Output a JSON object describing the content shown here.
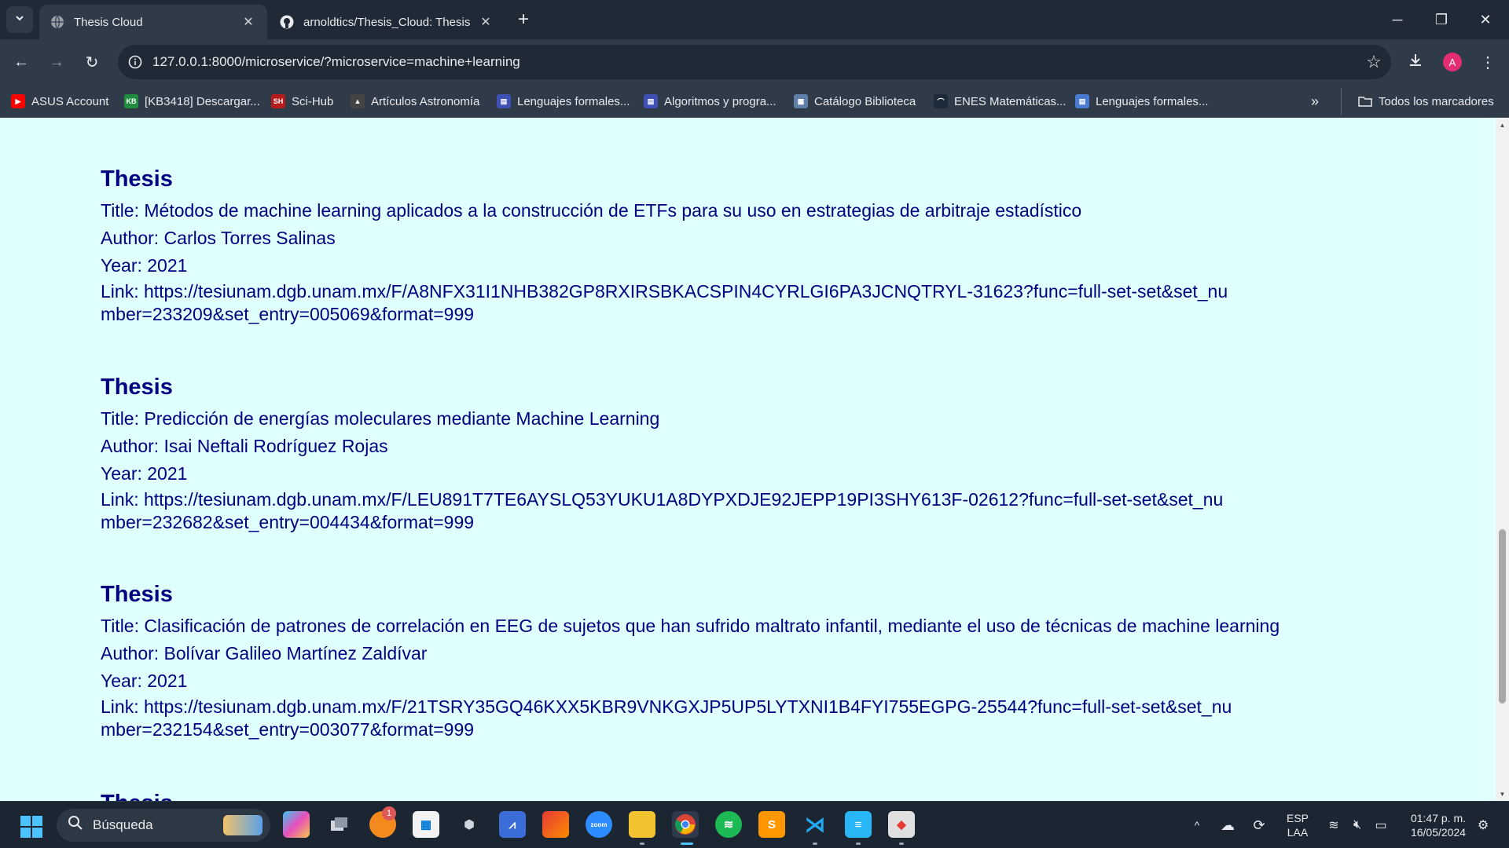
{
  "window": {
    "tabs": [
      {
        "title": "Thesis Cloud",
        "icon": "globe-icon",
        "active": true
      },
      {
        "title": "arnoldtics/Thesis_Cloud: Thesis",
        "icon": "github-icon",
        "active": false
      }
    ]
  },
  "toolbar": {
    "url": "127.0.0.1:8000/microservice/?microservice=machine+learning",
    "profile_initial": "A"
  },
  "bookmarks": {
    "items": [
      {
        "label": "ASUS Account",
        "icon": "youtube-icon",
        "color": "#ff0000"
      },
      {
        "label": "[KB3418] Descargar...",
        "icon": "kb-icon",
        "color": "#1e8e3e"
      },
      {
        "label": "Sci-Hub",
        "icon": "scihub-icon",
        "color": "#b71c1c"
      },
      {
        "label": "Artículos Astronomía",
        "icon": "astro-icon",
        "color": "#444444"
      },
      {
        "label": "Lenguajes formales...",
        "icon": "doc-icon",
        "color": "#3f51b5"
      },
      {
        "label": "Algoritmos y progra...",
        "icon": "doc-icon",
        "color": "#3f51b5"
      },
      {
        "label": "Catálogo Biblioteca",
        "icon": "catalog-icon",
        "color": "#5f7ea8"
      },
      {
        "label": "ENES Matemáticas...",
        "icon": "enes-icon",
        "color": "#1c2a3a"
      },
      {
        "label": "Lenguajes formales...",
        "icon": "doc-icon",
        "color": "#4a7bd0"
      }
    ],
    "all_label": "Todos los marcadores"
  },
  "content": {
    "theses": [
      {
        "heading": "Thesis",
        "title": "Title: Métodos de machine learning aplicados a la construcción de ETFs para su uso en estrategias de arbitraje estadístico",
        "author": "Author: Carlos Torres Salinas",
        "year": "Year: 2021",
        "link": "Link: https://tesiunam.dgb.unam.mx/F/A8NFX31I1NHB382GP8RXIRSBKACSPIN4CYRLGI6PA3JCNQTRYL-31623?func=full-set-set&set_number=233209&set_entry=005069&format=999"
      },
      {
        "heading": "Thesis",
        "title": "Title: Predicción de energías moleculares mediante Machine Learning",
        "author": "Author: Isai Neftali Rodríguez Rojas",
        "year": "Year: 2021",
        "link": "Link: https://tesiunam.dgb.unam.mx/F/LEU891T7TE6AYSLQ53YUKU1A8DYPXDJE92JEPP19PI3SHY613F-02612?func=full-set-set&set_number=232682&set_entry=004434&format=999"
      },
      {
        "heading": "Thesis",
        "title": "Title: Clasificación de patrones de correlación en EEG de sujetos que han sufrido maltrato infantil, mediante el uso de técnicas de machine learning",
        "author": "Author: Bolívar Galileo Martínez Zaldívar",
        "year": "Year: 2021",
        "link": "Link: https://tesiunam.dgb.unam.mx/F/21TSRY35GQ46KXX5KBR9VNKGXJP5UP5LYTXNI1B4FYI755EGPG-25544?func=full-set-set&set_number=232154&set_entry=003077&format=999"
      }
    ],
    "next_heading": "Thesis"
  },
  "taskbar": {
    "search_placeholder": "Búsqueda",
    "notification_badge": "1",
    "lang_top": "ESP",
    "lang_bottom": "LAA",
    "time": "01:47 p. m.",
    "date": "16/05/2024"
  },
  "colors": {
    "page_background": "#e0ffff",
    "text": "#000080"
  }
}
